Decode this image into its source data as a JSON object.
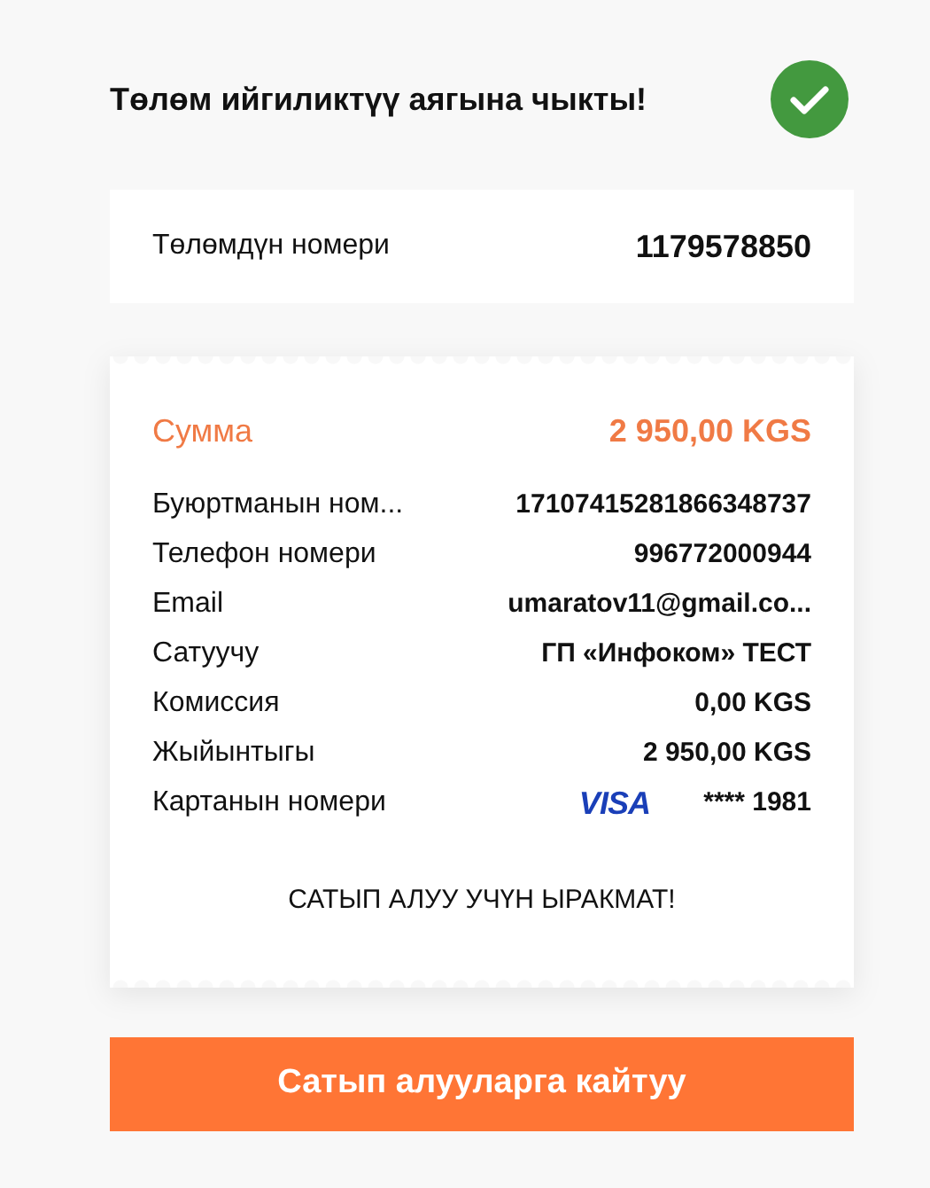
{
  "title": "Төлөм ийгиликтүү аягына чыкты!",
  "status": {
    "kind": "success"
  },
  "payment_number": {
    "label": "Төлөмдүн номери",
    "value": "1179578850"
  },
  "receipt": {
    "amount": {
      "label": "Сумма",
      "value": "2 950,00 KGS"
    },
    "rows": [
      {
        "kind": "text",
        "label": "Буюртманын ном...",
        "value": "17107415281866348737"
      },
      {
        "kind": "text",
        "label": "Телефон номери",
        "value": "996772000944"
      },
      {
        "kind": "text",
        "label": "Email",
        "value": "umaratov11@gmail.co..."
      },
      {
        "kind": "text",
        "label": "Сатуучу",
        "value": "ГП «Инфоком» ТЕСТ"
      },
      {
        "kind": "text",
        "label": "Комиссия",
        "value": "0,00 KGS"
      },
      {
        "kind": "text",
        "label": "Жыйынтыгы",
        "value": "2 950,00 KGS"
      },
      {
        "kind": "card",
        "label": "Картанын номери",
        "brand": "VISA",
        "value": "**** 1981"
      }
    ],
    "thanks": "САТЫП АЛУУ УЧҮН ЫРАКМАТ!"
  },
  "button": "Сатып алууларга кайтуу"
}
